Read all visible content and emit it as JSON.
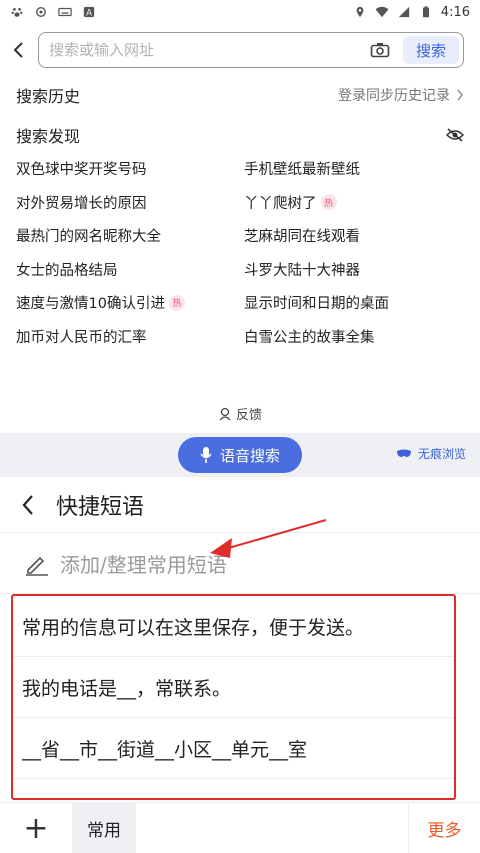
{
  "status_bar": {
    "time": "4:16"
  },
  "search": {
    "placeholder": "搜索或输入网址",
    "button_label": "搜索"
  },
  "history": {
    "title": "搜索历史",
    "sync_link": "登录同步历史记录"
  },
  "discover": {
    "title": "搜索发现",
    "items": [
      {
        "label": "双色球中奖开奖号码",
        "hot": false
      },
      {
        "label": "手机壁纸最新壁纸",
        "hot": false
      },
      {
        "label": "对外贸易增长的原因",
        "hot": false
      },
      {
        "label": "丫丫爬树了",
        "hot": true
      },
      {
        "label": "最热门的网名昵称大全",
        "hot": false
      },
      {
        "label": "芝麻胡同在线观看",
        "hot": false
      },
      {
        "label": "女士的品格结局",
        "hot": false
      },
      {
        "label": "斗罗大陆十大神器",
        "hot": false
      },
      {
        "label": "速度与激情10确认引进",
        "hot": true
      },
      {
        "label": "显示时间和日期的桌面",
        "hot": false
      },
      {
        "label": "加币对人民币的汇率",
        "hot": false
      },
      {
        "label": "白雪公主的故事全集",
        "hot": false
      }
    ],
    "hot_badge": "热"
  },
  "feedback_label": "反馈",
  "voice_search_label": "语音搜索",
  "incognito_label": "无痕浏览",
  "quick_phrases": {
    "title": "快捷短语",
    "add_label": "添加/整理常用短语",
    "items": [
      "常用的信息可以在这里保存，便于发送。",
      "我的电话是__，常联系。",
      "__省__市__街道__小区__单元__室"
    ]
  },
  "bottom_bar": {
    "plus": "+",
    "tab_common": "常用",
    "more": "更多"
  },
  "colors": {
    "accent": "#4a6ee0",
    "highlight_box": "#e02b2b",
    "more": "#f05a28"
  }
}
